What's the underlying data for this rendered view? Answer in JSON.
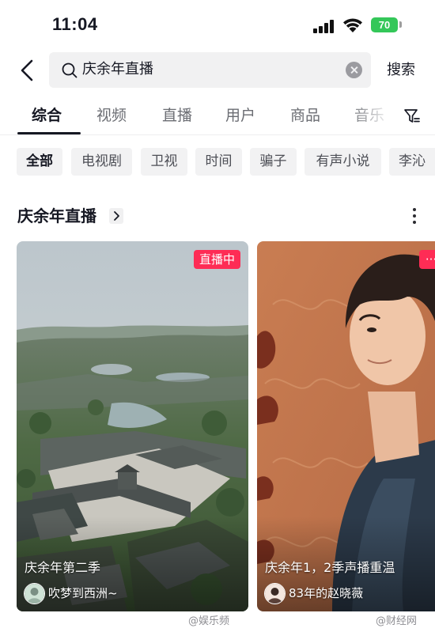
{
  "status_bar": {
    "time": "11:04",
    "battery": "70"
  },
  "search": {
    "query": "庆余年直播",
    "submit_label": "搜索"
  },
  "tabs": [
    {
      "label": "综合",
      "active": true
    },
    {
      "label": "视频"
    },
    {
      "label": "直播"
    },
    {
      "label": "用户"
    },
    {
      "label": "商品"
    },
    {
      "label": "音乐"
    }
  ],
  "filter_chips": [
    {
      "label": "全部",
      "active": true
    },
    {
      "label": "电视剧"
    },
    {
      "label": "卫视"
    },
    {
      "label": "时间"
    },
    {
      "label": "骗子"
    },
    {
      "label": "有声小说"
    },
    {
      "label": "李沁"
    }
  ],
  "section": {
    "title": "庆余年直播"
  },
  "cards": [
    {
      "badge": "直播中",
      "title": "庆余年第二季",
      "author": "吹梦到西洲~"
    },
    {
      "title": "庆余年1，2季声播重温",
      "author": "83年的赵晓薇"
    }
  ],
  "watermarks": {
    "left": "@娱乐频",
    "right": "@财经网"
  },
  "colors": {
    "accent": "#fe2c55",
    "battery": "#34c759",
    "chip_bg": "#f2f2f3",
    "search_bg": "#f1f1f2"
  }
}
